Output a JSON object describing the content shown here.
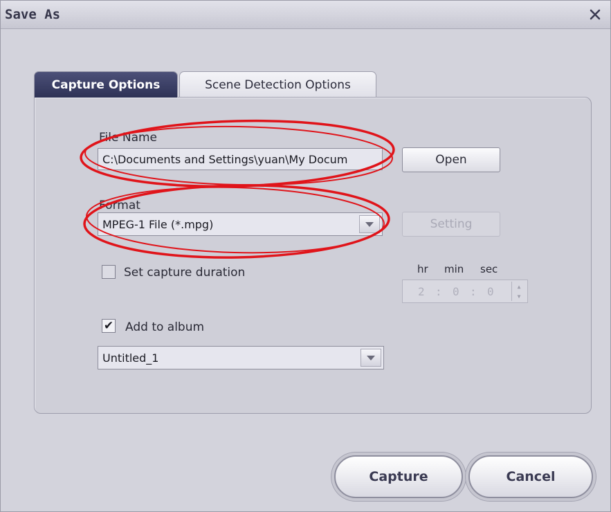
{
  "window": {
    "title": "Save As",
    "close_icon": "close-icon"
  },
  "tabs": [
    {
      "label": "Capture Options",
      "active": true
    },
    {
      "label": "Scene Detection Options",
      "active": false
    }
  ],
  "file_name": {
    "label": "File Name",
    "value": "C:\\Documents and Settings\\yuan\\My Docum",
    "open_label": "Open"
  },
  "format": {
    "label": "Format",
    "selected": "MPEG-1 File (*.mpg)",
    "setting_label": "Setting"
  },
  "capture_duration": {
    "label": "Set capture duration",
    "checked": false,
    "hr_label": "hr",
    "min_label": "min",
    "sec_label": "sec",
    "hours": "2",
    "minutes": "0",
    "seconds": "0",
    "separator": ":"
  },
  "album": {
    "label": "Add to album",
    "checked": true,
    "selected": "Untitled_1"
  },
  "actions": {
    "capture_label": "Capture",
    "cancel_label": "Cancel"
  },
  "colors": {
    "annotation": "#e0141a",
    "active_tab": "#3a3e66",
    "dialog_bg": "#d3d3dc"
  }
}
